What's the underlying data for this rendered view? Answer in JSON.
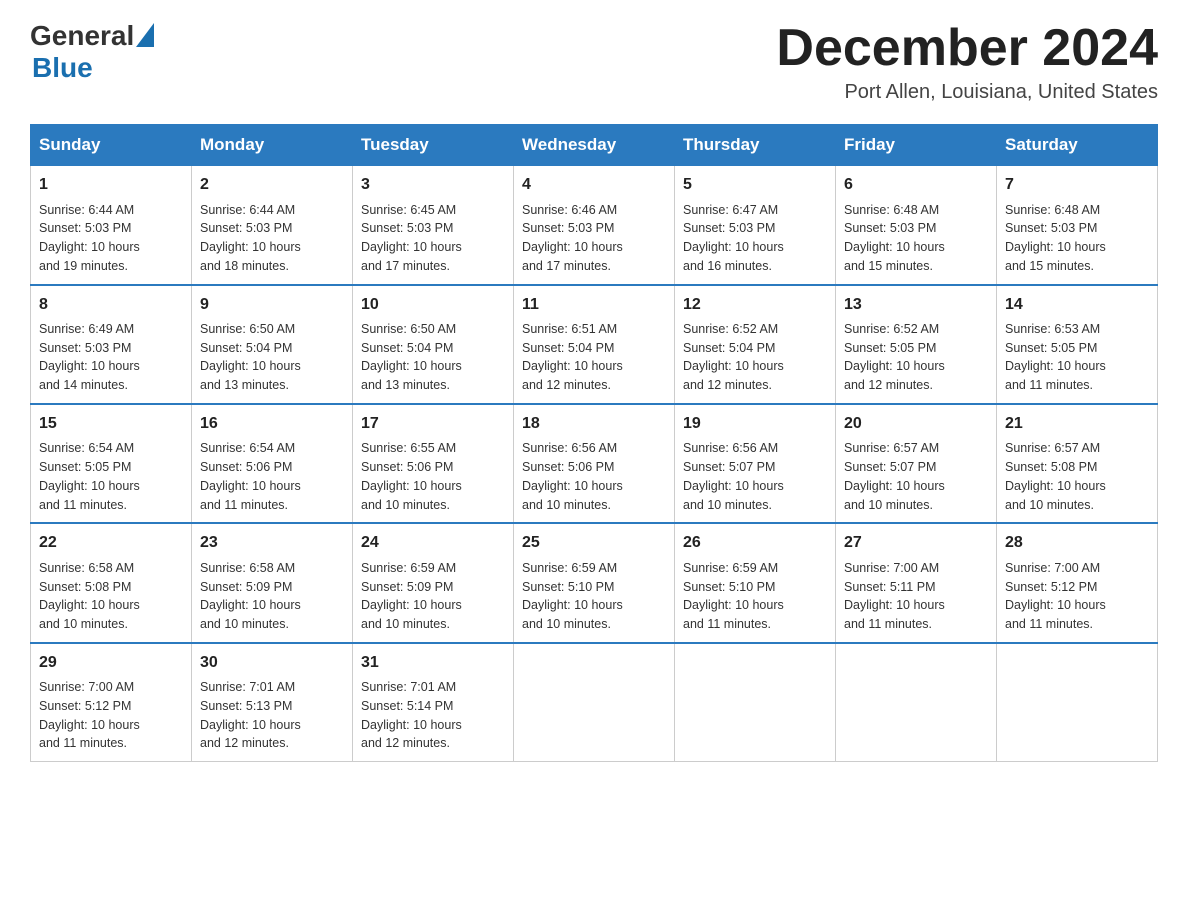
{
  "header": {
    "logo_general": "General",
    "logo_blue": "Blue",
    "month_title": "December 2024",
    "location": "Port Allen, Louisiana, United States"
  },
  "days_of_week": [
    "Sunday",
    "Monday",
    "Tuesday",
    "Wednesday",
    "Thursday",
    "Friday",
    "Saturday"
  ],
  "weeks": [
    [
      {
        "day": "1",
        "sunrise": "6:44 AM",
        "sunset": "5:03 PM",
        "daylight": "10 hours and 19 minutes."
      },
      {
        "day": "2",
        "sunrise": "6:44 AM",
        "sunset": "5:03 PM",
        "daylight": "10 hours and 18 minutes."
      },
      {
        "day": "3",
        "sunrise": "6:45 AM",
        "sunset": "5:03 PM",
        "daylight": "10 hours and 17 minutes."
      },
      {
        "day": "4",
        "sunrise": "6:46 AM",
        "sunset": "5:03 PM",
        "daylight": "10 hours and 17 minutes."
      },
      {
        "day": "5",
        "sunrise": "6:47 AM",
        "sunset": "5:03 PM",
        "daylight": "10 hours and 16 minutes."
      },
      {
        "day": "6",
        "sunrise": "6:48 AM",
        "sunset": "5:03 PM",
        "daylight": "10 hours and 15 minutes."
      },
      {
        "day": "7",
        "sunrise": "6:48 AM",
        "sunset": "5:03 PM",
        "daylight": "10 hours and 15 minutes."
      }
    ],
    [
      {
        "day": "8",
        "sunrise": "6:49 AM",
        "sunset": "5:03 PM",
        "daylight": "10 hours and 14 minutes."
      },
      {
        "day": "9",
        "sunrise": "6:50 AM",
        "sunset": "5:04 PM",
        "daylight": "10 hours and 13 minutes."
      },
      {
        "day": "10",
        "sunrise": "6:50 AM",
        "sunset": "5:04 PM",
        "daylight": "10 hours and 13 minutes."
      },
      {
        "day": "11",
        "sunrise": "6:51 AM",
        "sunset": "5:04 PM",
        "daylight": "10 hours and 12 minutes."
      },
      {
        "day": "12",
        "sunrise": "6:52 AM",
        "sunset": "5:04 PM",
        "daylight": "10 hours and 12 minutes."
      },
      {
        "day": "13",
        "sunrise": "6:52 AM",
        "sunset": "5:05 PM",
        "daylight": "10 hours and 12 minutes."
      },
      {
        "day": "14",
        "sunrise": "6:53 AM",
        "sunset": "5:05 PM",
        "daylight": "10 hours and 11 minutes."
      }
    ],
    [
      {
        "day": "15",
        "sunrise": "6:54 AM",
        "sunset": "5:05 PM",
        "daylight": "10 hours and 11 minutes."
      },
      {
        "day": "16",
        "sunrise": "6:54 AM",
        "sunset": "5:06 PM",
        "daylight": "10 hours and 11 minutes."
      },
      {
        "day": "17",
        "sunrise": "6:55 AM",
        "sunset": "5:06 PM",
        "daylight": "10 hours and 10 minutes."
      },
      {
        "day": "18",
        "sunrise": "6:56 AM",
        "sunset": "5:06 PM",
        "daylight": "10 hours and 10 minutes."
      },
      {
        "day": "19",
        "sunrise": "6:56 AM",
        "sunset": "5:07 PM",
        "daylight": "10 hours and 10 minutes."
      },
      {
        "day": "20",
        "sunrise": "6:57 AM",
        "sunset": "5:07 PM",
        "daylight": "10 hours and 10 minutes."
      },
      {
        "day": "21",
        "sunrise": "6:57 AM",
        "sunset": "5:08 PM",
        "daylight": "10 hours and 10 minutes."
      }
    ],
    [
      {
        "day": "22",
        "sunrise": "6:58 AM",
        "sunset": "5:08 PM",
        "daylight": "10 hours and 10 minutes."
      },
      {
        "day": "23",
        "sunrise": "6:58 AM",
        "sunset": "5:09 PM",
        "daylight": "10 hours and 10 minutes."
      },
      {
        "day": "24",
        "sunrise": "6:59 AM",
        "sunset": "5:09 PM",
        "daylight": "10 hours and 10 minutes."
      },
      {
        "day": "25",
        "sunrise": "6:59 AM",
        "sunset": "5:10 PM",
        "daylight": "10 hours and 10 minutes."
      },
      {
        "day": "26",
        "sunrise": "6:59 AM",
        "sunset": "5:10 PM",
        "daylight": "10 hours and 11 minutes."
      },
      {
        "day": "27",
        "sunrise": "7:00 AM",
        "sunset": "5:11 PM",
        "daylight": "10 hours and 11 minutes."
      },
      {
        "day": "28",
        "sunrise": "7:00 AM",
        "sunset": "5:12 PM",
        "daylight": "10 hours and 11 minutes."
      }
    ],
    [
      {
        "day": "29",
        "sunrise": "7:00 AM",
        "sunset": "5:12 PM",
        "daylight": "10 hours and 11 minutes."
      },
      {
        "day": "30",
        "sunrise": "7:01 AM",
        "sunset": "5:13 PM",
        "daylight": "10 hours and 12 minutes."
      },
      {
        "day": "31",
        "sunrise": "7:01 AM",
        "sunset": "5:14 PM",
        "daylight": "10 hours and 12 minutes."
      },
      null,
      null,
      null,
      null
    ]
  ],
  "labels": {
    "sunrise": "Sunrise:",
    "sunset": "Sunset:",
    "daylight": "Daylight:"
  }
}
